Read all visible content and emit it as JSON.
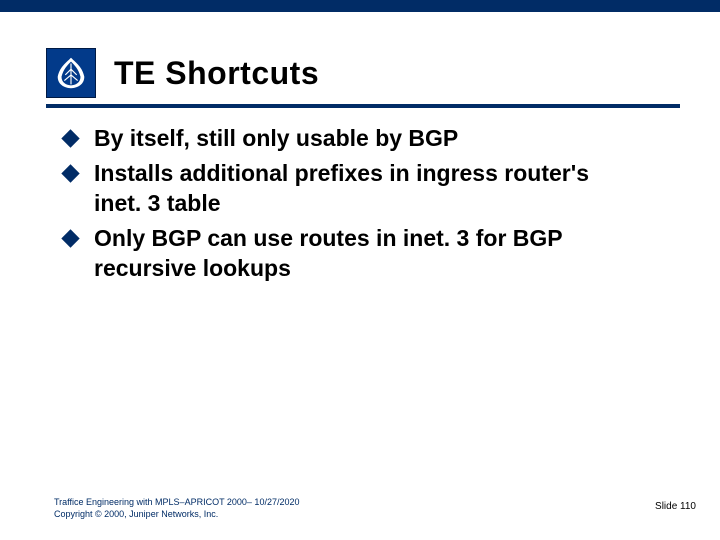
{
  "title": "TE Shortcuts",
  "bullets": [
    "By itself, still only usable by BGP",
    "Installs additional prefixes in ingress router's inet. 3 table",
    "Only BGP can use routes in inet. 3 for BGP recursive lookups"
  ],
  "footer": {
    "line1": "Traffice Engineering with MPLS–APRICOT 2000– 10/27/2020",
    "line2": "Copyright © 2000, Juniper Networks, Inc."
  },
  "slide_number": "Slide 110",
  "icons": {
    "logo": "leaf-icon"
  }
}
